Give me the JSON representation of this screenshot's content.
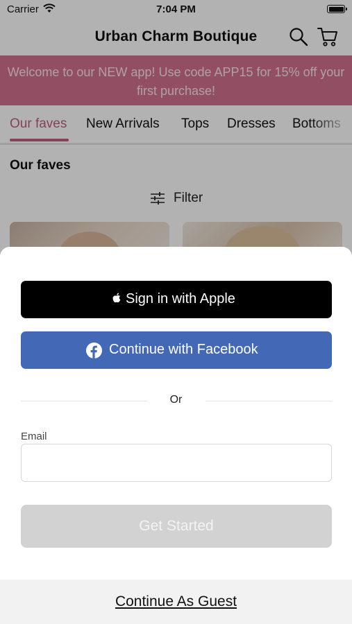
{
  "status_bar": {
    "carrier": "Carrier",
    "time": "7:04 PM"
  },
  "header": {
    "title": "Urban Charm Boutique",
    "icons": [
      "search-icon",
      "cart-icon"
    ]
  },
  "promo": {
    "text": "Welcome to our NEW app! Use code APP15 for 15% off your first purchase!"
  },
  "tabs": [
    {
      "label": "Our faves",
      "active": true
    },
    {
      "label": "New Arrivals"
    },
    {
      "label": "Tops"
    },
    {
      "label": "Dresses"
    },
    {
      "label": "Bottoms"
    }
  ],
  "section": {
    "title": "Our faves",
    "filter_label": "Filter"
  },
  "sheet": {
    "apple_label": "Sign in with Apple",
    "facebook_label": "Continue with Facebook",
    "or_label": "Or",
    "email_label": "Email",
    "email_value": "",
    "email_placeholder": "",
    "get_started_label": "Get Started",
    "guest_label": "Continue As Guest"
  },
  "colors": {
    "promo_bg": "#d2728f",
    "accent": "#c25d79",
    "facebook": "#4268b6",
    "apple": "#000000",
    "disabled_button": "#d2d2d2"
  }
}
